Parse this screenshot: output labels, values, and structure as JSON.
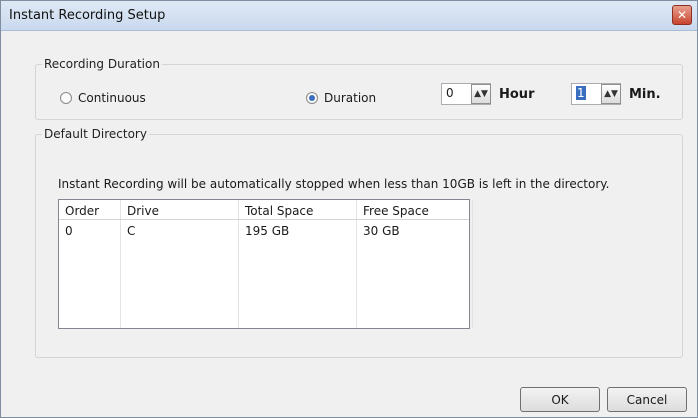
{
  "window": {
    "title": "Instant Recording Setup",
    "close_glyph": "✕"
  },
  "recording_duration": {
    "legend": "Recording Duration",
    "options": [
      {
        "label": "Continuous",
        "checked": false
      },
      {
        "label": "Duration",
        "checked": true
      }
    ],
    "hour": {
      "value": "0",
      "unit": "Hour"
    },
    "min": {
      "value": "1",
      "unit": "Min."
    }
  },
  "default_directory": {
    "legend": "Default Directory",
    "message": "Instant Recording will be automatically stopped when less than 10GB is left in the directory.",
    "table": {
      "headers": [
        "Order",
        "Drive",
        "Total Space",
        "Free Space"
      ],
      "rows": [
        [
          "0",
          "C",
          "195 GB",
          "30 GB"
        ]
      ]
    }
  },
  "buttons": {
    "ok": "OK",
    "cancel": "Cancel"
  },
  "colors": {
    "accent": "#3a6fbf",
    "close": "#c8452f"
  }
}
